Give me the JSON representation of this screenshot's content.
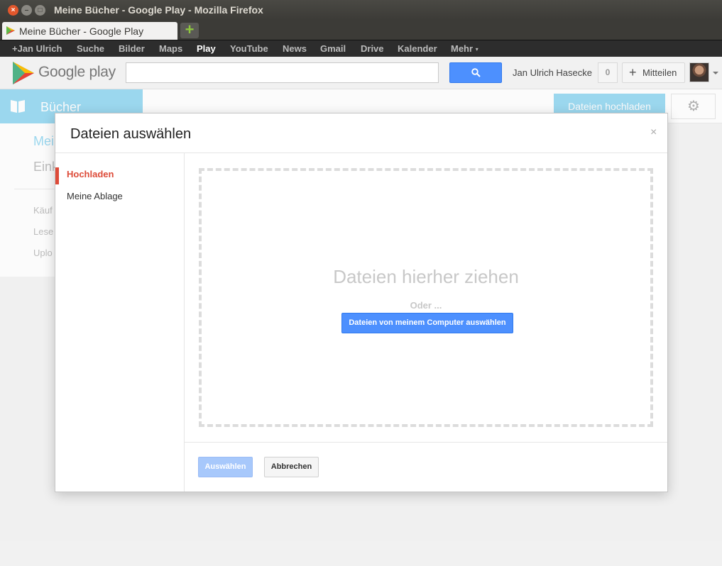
{
  "window": {
    "title": "Meine Bücher - Google Play - Mozilla Firefox",
    "close_glyph": "×",
    "min_glyph": "–",
    "max_glyph": "□"
  },
  "browser": {
    "tab_label": "Meine Bücher - Google Play",
    "new_tab_glyph": "+"
  },
  "gbar": {
    "items": [
      "+Jan Ulrich",
      "Suche",
      "Bilder",
      "Maps",
      "Play",
      "YouTube",
      "News",
      "Gmail",
      "Drive",
      "Kalender",
      "Mehr"
    ],
    "active": "Play",
    "more_caret": "▾"
  },
  "header": {
    "logo_text": "Google play",
    "search_value": "",
    "username": "Jan Ulrich Hasecke",
    "notification_count": "0",
    "share_plus": "+",
    "share_label": "Mitteilen"
  },
  "background": {
    "section_label": "Bücher",
    "upload_button": "Dateien hochladen",
    "gear_glyph": "⚙",
    "side_items": [
      "Mei",
      "Eink",
      "Käuf",
      "Lese",
      "Uplo"
    ]
  },
  "dialog": {
    "title": "Dateien auswählen",
    "close_glyph": "×",
    "nav": [
      {
        "label": "Hochladen",
        "active": true
      },
      {
        "label": "Meine Ablage",
        "active": false
      }
    ],
    "drop_title": "Dateien hierher ziehen",
    "drop_or": "Oder ...",
    "pick_button": "Dateien von meinem Computer auswählen",
    "select_button": "Auswählen",
    "cancel_button": "Abbrechen"
  },
  "colors": {
    "accent_blue": "#4d90fe",
    "light_blue": "#7fcfee",
    "active_red": "#dd4b39",
    "disabled_blue": "#a7c8fb"
  }
}
